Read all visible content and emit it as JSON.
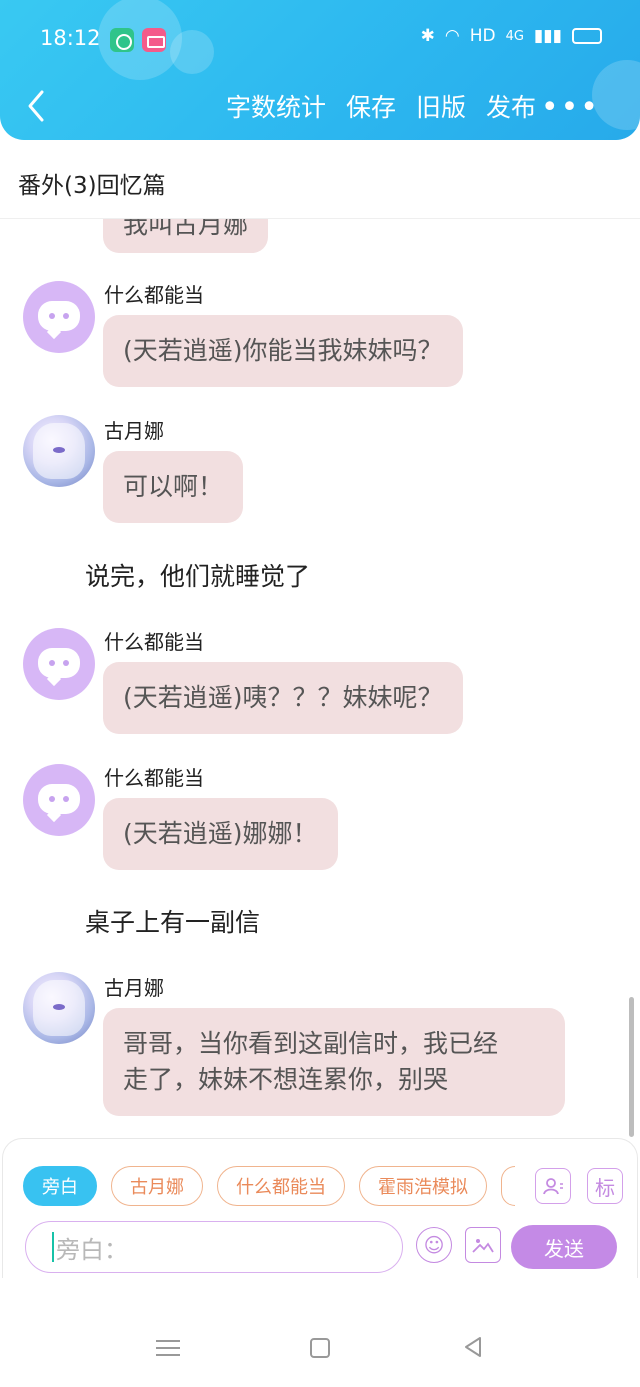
{
  "status_bar": {
    "time": "18:12",
    "network_label": "HD",
    "signal_label": "4G",
    "battery_color": "#f7d21c"
  },
  "toolbar": {
    "word_count": "字数统计",
    "save": "保存",
    "old_version": "旧版",
    "publish": "发布",
    "more": "•••"
  },
  "chapter": {
    "title": "番外(3)回忆篇"
  },
  "messages": [
    {
      "type": "partial",
      "text": "我叫古月娜"
    },
    {
      "type": "chat",
      "name": "什么都能当",
      "avatar": "chat-bubble-avatar",
      "text": "(天若逍遥)你能当我妹妹吗？"
    },
    {
      "type": "chat",
      "name": "古月娜",
      "avatar": "anime-girl-avatar",
      "text": "可以啊！"
    },
    {
      "type": "narration",
      "text": "说完，他们就睡觉了"
    },
    {
      "type": "chat",
      "name": "什么都能当",
      "avatar": "chat-bubble-avatar",
      "text": "(天若逍遥)咦？？？妹妹呢？"
    },
    {
      "type": "chat",
      "name": "什么都能当",
      "avatar": "chat-bubble-avatar",
      "text": "(天若逍遥)娜娜！"
    },
    {
      "type": "narration",
      "text": "桌子上有一副信"
    },
    {
      "type": "chat",
      "name": "古月娜",
      "avatar": "anime-girl-avatar",
      "text_line1": "哥哥，当你看到这副信时，我已经",
      "text_line2": "走了，妹妹不想连累你，别哭"
    }
  ],
  "roles": [
    {
      "label": "旁白",
      "active": true
    },
    {
      "label": "古月娜",
      "active": false
    },
    {
      "label": "什么都能当",
      "active": false
    },
    {
      "label": "霍雨浩模拟",
      "active": false
    }
  ],
  "tools": {
    "tag_label": "标",
    "input_placeholder": "旁白：",
    "send_label": "发送"
  },
  "colors": {
    "header": "#2cb6ef",
    "bubble": "#f2dfe0",
    "accent_purple": "#c48ae6",
    "accent_blue": "#38c2f1"
  }
}
